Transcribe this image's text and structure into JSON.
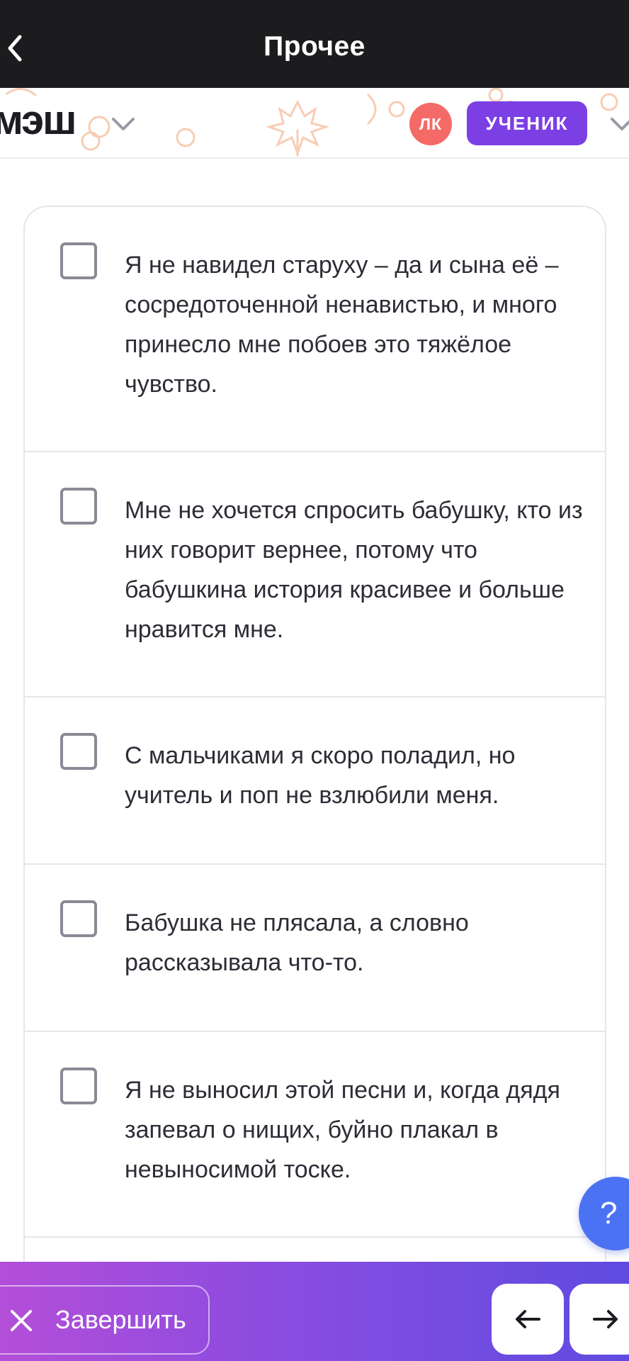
{
  "topbar": {
    "title": "Прочее"
  },
  "header": {
    "logo": "мэш",
    "avatar_initials": "ЛК",
    "role": "УЧЕНИК"
  },
  "options": [
    {
      "text": "Я не навидел старуху – да и сына её – сосредоточенной ненавистью, и много принесло мне побоев это тяжёлое чувство.",
      "checked": false
    },
    {
      "text": "Мне не хочется спросить бабушку, кто из них говорит вернее, потому что бабушкина история красивее и больше нравится мне.",
      "checked": false
    },
    {
      "text": "С мальчиками я скоро поладил, но учитель и поп не взлюбили меня.",
      "checked": false
    },
    {
      "text": "Бабушка не плясала, а словно рассказывала что-то.",
      "checked": false
    },
    {
      "text": "Я не выносил этой песни и, когда дядя запевал о нищих, буйно плакал в невыносимой тоске.",
      "checked": false
    }
  ],
  "help": {
    "label": "?"
  },
  "bottombar": {
    "finish_label": "Завершить"
  },
  "colors": {
    "accent": "#7c3fe4",
    "avatar": "#f46a66",
    "help": "#4b72f3",
    "topbar": "#1c1c1e"
  }
}
